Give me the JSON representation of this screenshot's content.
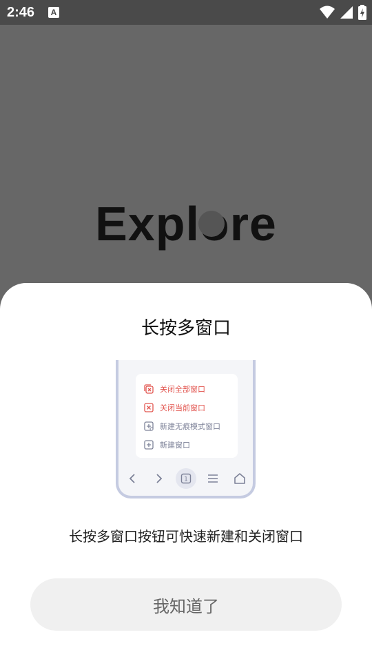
{
  "status_bar": {
    "time": "2:46",
    "notification_letter": "A",
    "icons": [
      "wifi-icon",
      "signal-icon",
      "battery-charging-icon"
    ]
  },
  "background": {
    "logo_text": "Explore"
  },
  "sheet": {
    "title": "长按多窗口",
    "illustration": {
      "menu_items": [
        {
          "label": "关闭全部窗口",
          "icon": "close-all-icon",
          "color": "#e2544e"
        },
        {
          "label": "关闭当前窗口",
          "icon": "close-current-icon",
          "color": "#e2544e"
        },
        {
          "label": "新建无痕模式窗口",
          "icon": "incognito-window-icon",
          "color": "#7d8298"
        },
        {
          "label": "新建窗口",
          "icon": "new-window-icon",
          "color": "#7d8298"
        }
      ],
      "tab_count": "1",
      "nav_icons": [
        "back-icon",
        "forward-icon",
        "tabs-icon",
        "menu-icon",
        "home-icon"
      ]
    },
    "description": "长按多窗口按钮可快速新建和关闭窗口",
    "confirm_button": "我知道了"
  },
  "colors": {
    "overlay": "#676767",
    "sheet_bg": "#ffffff",
    "accent_red": "#e2544e",
    "phone_frame": "#c5cbe1",
    "button_bg": "#f0f0f0"
  }
}
